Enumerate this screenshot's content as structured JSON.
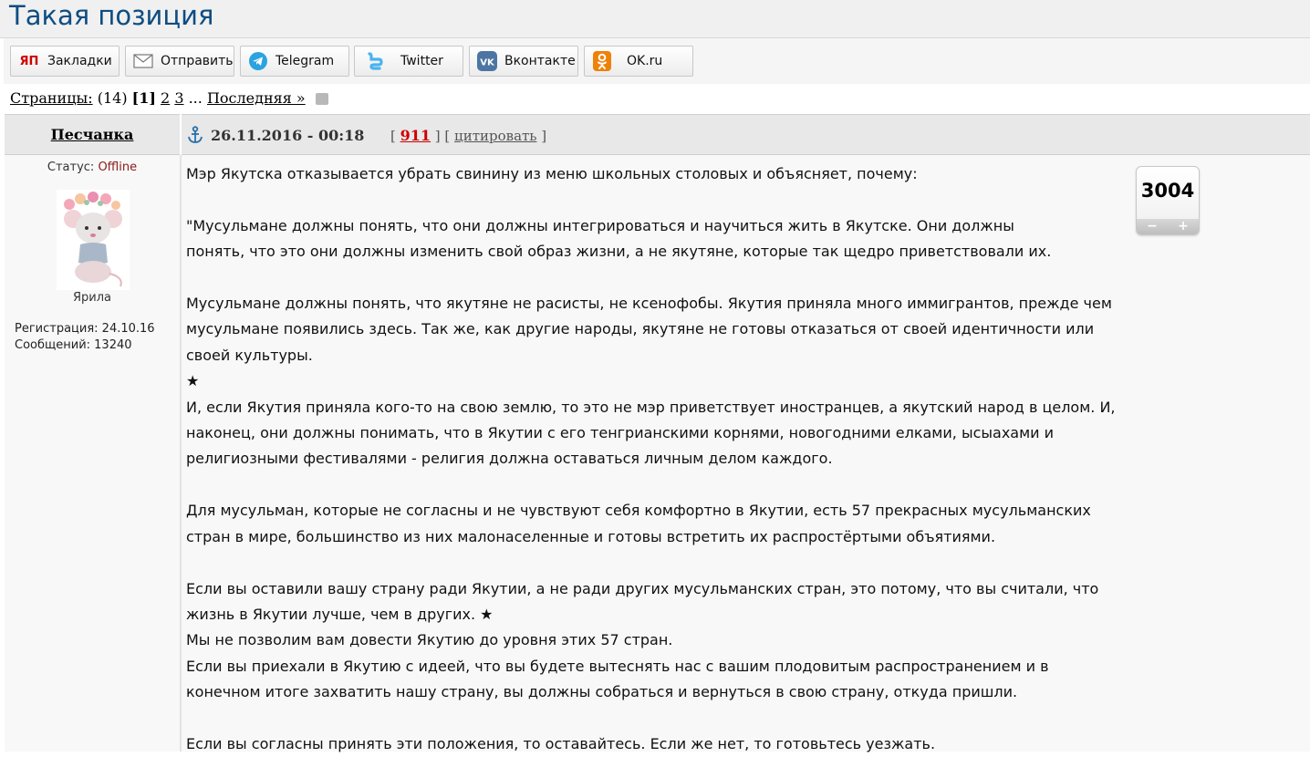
{
  "topic": {
    "title": "Такая позиция"
  },
  "share": {
    "buttons": [
      {
        "label": "Закладки",
        "icon": "yandex-bookmarks-icon"
      },
      {
        "label": "Отправить",
        "icon": "envelope-icon"
      },
      {
        "label": "Telegram",
        "icon": "telegram-icon"
      },
      {
        "label": "Twitter",
        "icon": "twitter-icon"
      },
      {
        "label": "Вконтакте",
        "icon": "vk-icon"
      },
      {
        "label": "OK.ru",
        "icon": "odnoklassniki-icon"
      }
    ],
    "yandex_logo_text": "ЯП"
  },
  "pagination": {
    "label": "Страницы:",
    "total": "(14)",
    "current": "[1]",
    "pages": [
      "2",
      "3"
    ],
    "ellipsis": "...",
    "last_label": "Последняя »"
  },
  "post": {
    "author": "Песчанка",
    "date": "26.11.2016 - 00:18",
    "number": "911",
    "quote_label": "цитировать",
    "status_label": "Статус:",
    "status_value": "Offline",
    "rank": "Ярила",
    "reg_label": "Регистрация: 24.10.16",
    "posts_label": "Сообщений: 13240",
    "rating": "3004",
    "rating_minus": "−",
    "rating_plus": "+",
    "text": "Мэр Якутска отказывается убрать свинину из меню школьных столовых и объясняет, почему:\n\n\"Мусульмане должны понять, что они должны интегрироваться и научиться жить в Якутске. Они должны\nпонять, что это они должны изменить свой образ жизни, а не якутяне, которые так щедро приветствовали их.\n\nМусульмане должны понять, что якутяне не расисты, не ксенофобы. Якутия приняла много иммигрантов, прежде чем\nмусульмане появились здесь. Так же, как другие народы, якутяне не готовы отказаться от своей идентичности или\nсвоей культуры.\n★\nИ, если Якутия приняла кого-то на свою землю, то это не мэр приветствует иностранцев, а якутский народ в целом. И,\nнаконец, они должны понимать, что в Якутии с его тенгрианскими корнями, новогодними елками, ысыахами и\nрелигиозными фестивалями - религия должна оставаться личным делом каждого.\n\nДля мусульман, которые не согласны и не чувствуют себя комфортно в Якутии, есть 57 прекрасных мусульманских\nстран в мире, большинство из них малонаселенные и готовы встретить их распростёртыми объятиями.\n\nЕсли вы оставили вашу страну ради Якутии, а не ради других мусульманских стран, это потому, что вы считали, что\nжизнь в Якутии лучше, чем в других. ★\nМы не позволим вам довести Якутию до уровня этих 57 стран.\nЕсли вы приехали в Якутию с идеей, что вы будете вытеснять нас с вашим плодовитым распространением и в\nконечном итоге захватить нашу страну, вы должны собраться и вернуться в свою страну, откуда пришли.\n\nЕсли вы согласны принять эти положения, то оставайтесь. Если же нет, то готовьтесь уезжать."
  },
  "colors": {
    "title": "#0e4d82",
    "telegram": "#2aa3df",
    "twitter": "#49b3f0",
    "vk": "#4c75a3",
    "ok": "#ee8208",
    "yandex": "#cc0000",
    "offline": "#8b1a1a",
    "post_number": "#cc0000"
  }
}
